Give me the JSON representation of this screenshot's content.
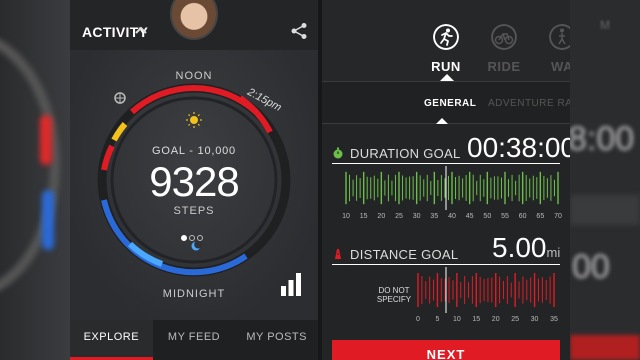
{
  "left": {
    "header": {
      "title": "ACTIVITY"
    },
    "dial": {
      "top_label": "NOON",
      "time_label": "2:15pm",
      "goal_label": "GOAL - 10,000",
      "steps_value": "9328",
      "steps_label": "STEPS",
      "bottom_label": "MIDNIGHT",
      "page_dots_active": 0
    },
    "tabs": [
      {
        "label": "EXPLORE",
        "active": true
      },
      {
        "label": "MY FEED",
        "active": false
      },
      {
        "label": "MY POSTS",
        "active": false
      }
    ],
    "colors": {
      "red": "#e01b24",
      "yellow": "#f2c21b",
      "blue": "#2a6ad8",
      "green": "#6cc04a"
    }
  },
  "right": {
    "sports": [
      {
        "label": "RUN",
        "icon": "runner-icon",
        "active": true
      },
      {
        "label": "RIDE",
        "icon": "bike-icon",
        "active": false
      },
      {
        "label": "WA",
        "icon": "walk-icon",
        "active": false
      }
    ],
    "subtabs": [
      {
        "label": "GENERAL",
        "active": true
      },
      {
        "label": "ADVENTURE RAC",
        "active": false
      }
    ],
    "duration": {
      "label": "DURATION GOAL",
      "value": "00:38:00",
      "ticks": [
        "10",
        "15",
        "20",
        "25",
        "30",
        "35",
        "40",
        "45",
        "50",
        "55",
        "60",
        "65",
        "70"
      ]
    },
    "distance": {
      "label": "DISTANCE GOAL",
      "value": "5.00",
      "unit": "mi",
      "not_specify": "DO NOT SPECIFY",
      "ticks": [
        "0",
        "5",
        "10",
        "15",
        "20",
        "25",
        "30",
        "35"
      ]
    },
    "next_label": "NEXT"
  },
  "blurred_right": {
    "top": "M",
    "mid": "8:00",
    "low": "00"
  }
}
